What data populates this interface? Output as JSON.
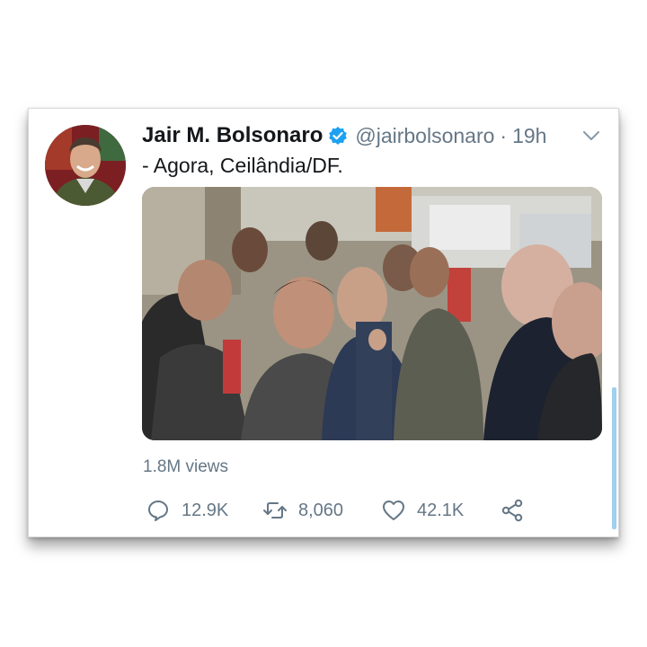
{
  "tweet": {
    "author": {
      "display_name": "Jair M. Bolsonaro",
      "handle": "@jairbolsonaro",
      "verified": true,
      "avatar_icon": "profile-photo"
    },
    "separator": "·",
    "time": "19h",
    "text": "- Agora, Ceilândia/DF.",
    "media": {
      "type": "video"
    },
    "views": "1.8M views",
    "actions": {
      "reply_count": "12.9K",
      "retweet_count": "8,060",
      "like_count": "42.1K"
    }
  },
  "colors": {
    "verified_blue": "#1da1f2",
    "secondary_text": "#657786",
    "primary_text": "#14171a",
    "scrollbar": "#9fd0ee"
  }
}
